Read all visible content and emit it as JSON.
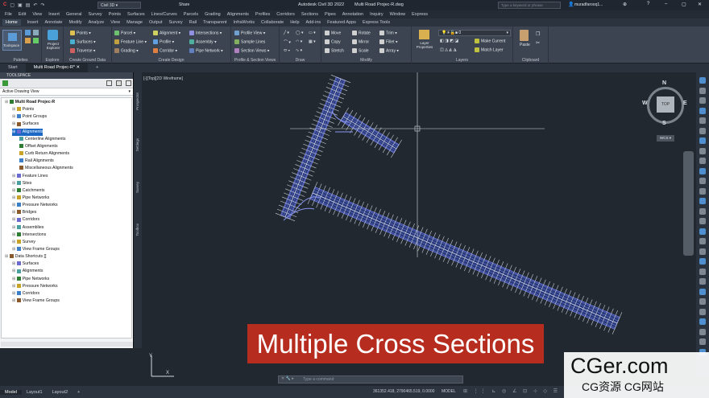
{
  "titlebar": {
    "workspace": "Civil 3D",
    "share": "Share",
    "app_title": "Autodesk Civil 3D 2022",
    "file_name": "Multi Road Projec-R.dwg",
    "search_placeholder": "Type a keyword or phrase",
    "user": "muradfarooq1..."
  },
  "menubar": [
    "File",
    "Edit",
    "View",
    "Insert",
    "General",
    "Survey",
    "Points",
    "Surfaces",
    "Lines/Curves",
    "Parcels",
    "Grading",
    "Alignments",
    "Profiles",
    "Corridors",
    "Sections",
    "Pipes",
    "Annotation",
    "Inquiry",
    "Window",
    "Express"
  ],
  "ribbon_tabs": [
    "Home",
    "Insert",
    "Annotate",
    "Modify",
    "Analyze",
    "View",
    "Manage",
    "Output",
    "Survey",
    "Rail",
    "Transparent",
    "InfraWorks",
    "Collaborate",
    "Help",
    "Add-ins",
    "Featured Apps",
    "Express Tools"
  ],
  "ribbon": {
    "palettes": {
      "label": "Palettes",
      "toolspace": "Toolspace"
    },
    "explore": {
      "label": "Explore",
      "project_explorer": "Project Explorer"
    },
    "create_ground": {
      "label": "Create Ground Data",
      "points": "Points",
      "surfaces": "Surfaces",
      "traverse": "Traverse"
    },
    "create_design": {
      "label": "Create Design",
      "parcel": "Parcel",
      "feature_line": "Feature Line",
      "grading": "Grading",
      "alignment": "Alignment",
      "profile": "Profile",
      "corridor": "Corridor",
      "intersections": "Intersections",
      "assembly": "Assembly",
      "pipe_network": "Pipe Network"
    },
    "profile_section": {
      "label": "Profile & Section Views",
      "profile_view": "Profile View",
      "sample_lines": "Sample Lines",
      "section_views": "Section Views"
    },
    "draw": {
      "label": "Draw"
    },
    "modify": {
      "label": "Modify",
      "move": "Move",
      "rotate": "Rotate",
      "trim": "Trim",
      "copy": "Copy",
      "mirror": "Mirror",
      "fillet": "Fillet",
      "stretch": "Stretch",
      "scale": "Scale",
      "array": "Array"
    },
    "layers": {
      "label": "Layers",
      "layer_properties": "Layer Properties",
      "layer_value": "0",
      "make_current": "Make Current",
      "match_layer": "Match Layer"
    },
    "clipboard": {
      "label": "Clipboard",
      "paste": "Paste"
    }
  },
  "doc_tabs": {
    "start": "Start",
    "active": "Multi Road Projec-R*"
  },
  "toolspace": {
    "header": "TOOLSPACE",
    "view": "Active Drawing View",
    "tree": [
      {
        "label": "Multi Road Projec-R",
        "level": 0,
        "bold": true
      },
      {
        "label": "Points",
        "level": 1
      },
      {
        "label": "Point Groups",
        "level": 1
      },
      {
        "label": "Surfaces",
        "level": 1
      },
      {
        "label": "Alignments",
        "level": 1,
        "selected": true
      },
      {
        "label": "Centerline Alignments",
        "level": 2
      },
      {
        "label": "Offset Alignments",
        "level": 2
      },
      {
        "label": "Curb Return Alignments",
        "level": 2
      },
      {
        "label": "Rail Alignments",
        "level": 2
      },
      {
        "label": "Miscellaneous Alignments",
        "level": 2
      },
      {
        "label": "Feature Lines",
        "level": 1
      },
      {
        "label": "Sites",
        "level": 1
      },
      {
        "label": "Catchments",
        "level": 1
      },
      {
        "label": "Pipe Networks",
        "level": 1
      },
      {
        "label": "Pressure Networks",
        "level": 1
      },
      {
        "label": "Bridges",
        "level": 1
      },
      {
        "label": "Corridors",
        "level": 1
      },
      {
        "label": "Assemblies",
        "level": 1
      },
      {
        "label": "Intersections",
        "level": 1
      },
      {
        "label": "Survey",
        "level": 1
      },
      {
        "label": "View Frame Groups",
        "level": 1
      },
      {
        "label": "Data Shortcuts []",
        "level": 0
      },
      {
        "label": "Surfaces",
        "level": 1
      },
      {
        "label": "Alignments",
        "level": 1
      },
      {
        "label": "Pipe Networks",
        "level": 1
      },
      {
        "label": "Pressure Networks",
        "level": 1
      },
      {
        "label": "Corridors",
        "level": 1
      },
      {
        "label": "View Frame Groups",
        "level": 1
      }
    ]
  },
  "side_tabs": [
    "Prospector",
    "Settings",
    "Survey",
    "Toolbox"
  ],
  "viewport": {
    "label": "[-][Top][2D Wireframe]",
    "viewcube": {
      "top": "TOP",
      "n": "N",
      "s": "S",
      "e": "E",
      "w": "W",
      "wcs": "WCS"
    }
  },
  "command": {
    "placeholder": "Type a command"
  },
  "status": {
    "layouts": [
      "Model",
      "Layout1",
      "Layout2"
    ],
    "coords": "361352.418, 2790465.519, 0.0000",
    "mode": "MODEL"
  },
  "caption": "Multiple Cross Sections",
  "watermark": {
    "line1": "CGer.com",
    "line2": "CG资源 CG网站"
  },
  "colors": {
    "accent": "#1b69c5",
    "caption_bg": "#b62d20",
    "road": "#6f7ce8"
  }
}
